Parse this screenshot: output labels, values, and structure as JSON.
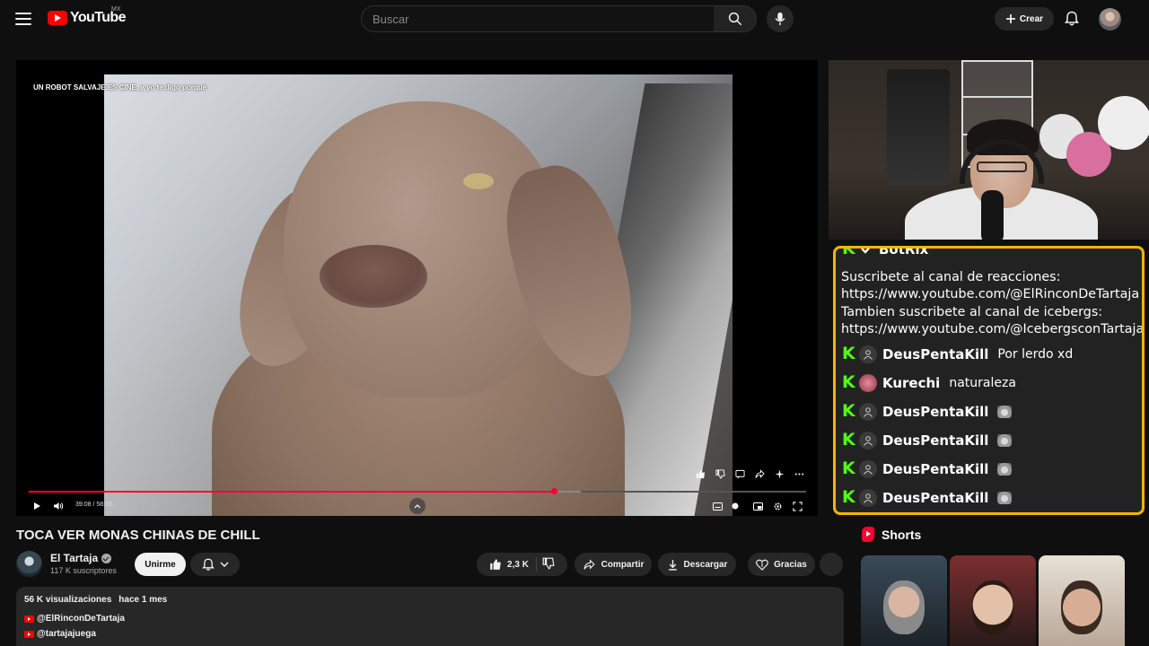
{
  "header": {
    "logo_text": "YouTube",
    "country_code": "MX",
    "search_placeholder": "Buscar",
    "create_label": "Crear"
  },
  "player": {
    "overlay_caption": "UN ROBOT SALVAJE ES CINE, y yo te digo porqué",
    "time_current": "39:08",
    "time_total": "58:06",
    "progress_played": 0.675,
    "progress_loaded": 0.71
  },
  "video": {
    "title": "TOCA VER MONAS CHINAS DE CHILL",
    "channel_name": "El Tartaja",
    "subscribers": "117 K suscriptores",
    "join_label": "Unirme",
    "likes": "2,3 K",
    "share_label": "Compartir",
    "download_label": "Descargar",
    "thanks_label": "Gracias"
  },
  "description": {
    "views": "56 K visualizaciones",
    "date": "hace 1 mes",
    "links": [
      "@ElRinconDeTartaja",
      "@tartajajuega"
    ]
  },
  "chat": {
    "bot_name": "BotRix",
    "bot_lines": [
      "Suscribete al canal de reacciones:",
      "https://www.youtube.com/@ElRinconDeTartaja",
      "Tambien suscribete al canal de icebergs:",
      "https://www.youtube.com/@IcebergsconTartaja"
    ],
    "messages": [
      {
        "user": "DeusPentaKill",
        "text": "Por lerdo xd"
      },
      {
        "user": "Kurechi",
        "text": "naturaleza"
      },
      {
        "user": "DeusPentaKill",
        "text": ""
      },
      {
        "user": "DeusPentaKill",
        "text": ""
      },
      {
        "user": "DeusPentaKill",
        "text": ""
      },
      {
        "user": "DeusPentaKill",
        "text": ""
      }
    ]
  },
  "shorts": {
    "title": "Shorts"
  },
  "colors": {
    "accent_red": "#ff0033",
    "chat_border": "#f7b500",
    "kick_green": "#53fc18"
  }
}
